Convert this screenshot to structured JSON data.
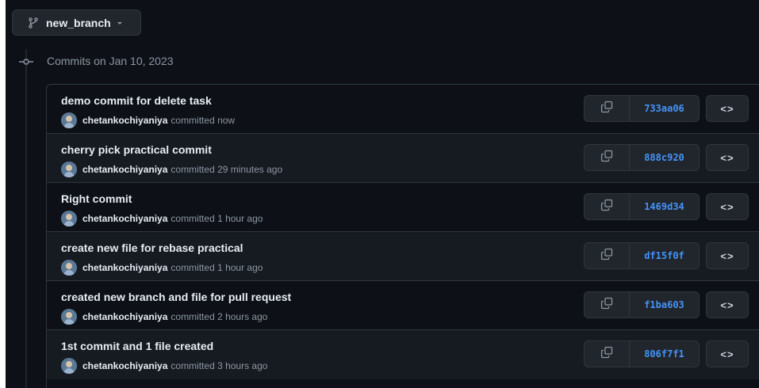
{
  "branch": {
    "name": "new_branch",
    "icon": "git-branch-icon",
    "caret_icon": "triangle-down-icon"
  },
  "group": {
    "heading": "Commits on Jan 10, 2023",
    "node_icon": "git-commit-icon"
  },
  "colors": {
    "background": "#0d1117",
    "row_alt": "#161b22",
    "border": "#30363d",
    "sha": "#4493f8",
    "text": "#e6edf3",
    "muted": "#8d96a0"
  },
  "commits": [
    {
      "title": "demo commit for delete task",
      "author": "chetankochiyaniya",
      "committed": "committed now",
      "sha": "733aa06",
      "copy_icon": "copy-icon",
      "browse_label": "<>"
    },
    {
      "title": "cherry pick practical commit",
      "author": "chetankochiyaniya",
      "committed": "committed 29 minutes ago",
      "sha": "888c920",
      "copy_icon": "copy-icon",
      "browse_label": "<>"
    },
    {
      "title": "Right commit",
      "author": "chetankochiyaniya",
      "committed": "committed 1 hour ago",
      "sha": "1469d34",
      "copy_icon": "copy-icon",
      "browse_label": "<>"
    },
    {
      "title": "create new file for rebase practical",
      "author": "chetankochiyaniya",
      "committed": "committed 1 hour ago",
      "sha": "df15f0f",
      "copy_icon": "copy-icon",
      "browse_label": "<>"
    },
    {
      "title": "created new branch and file for pull request",
      "author": "chetankochiyaniya",
      "committed": "committed 2 hours ago",
      "sha": "f1ba603",
      "copy_icon": "copy-icon",
      "browse_label": "<>"
    },
    {
      "title": "1st commit and 1 file created",
      "author": "chetankochiyaniya",
      "committed": "committed 3 hours ago",
      "sha": "806f7f1",
      "copy_icon": "copy-icon",
      "browse_label": "<>"
    }
  ]
}
